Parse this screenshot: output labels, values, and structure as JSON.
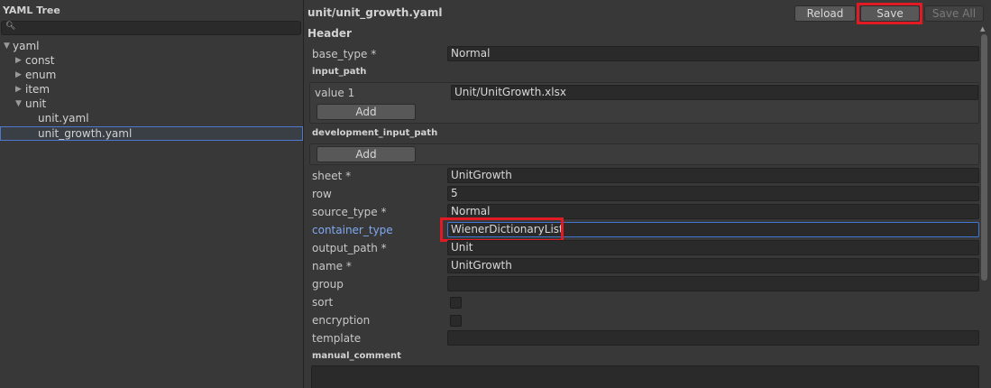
{
  "tree_panel": {
    "title": "YAML Tree",
    "search_placeholder": "",
    "items": [
      {
        "label": "yaml",
        "expanded": true
      },
      {
        "label": "const",
        "expanded": false
      },
      {
        "label": "enum",
        "expanded": false
      },
      {
        "label": "item",
        "expanded": false
      },
      {
        "label": "unit",
        "expanded": true
      },
      {
        "label": "unit.yaml"
      },
      {
        "label": "unit_growth.yaml",
        "selected": true
      }
    ]
  },
  "editor": {
    "file_title": "unit/unit_growth.yaml",
    "section": "Header",
    "buttons": {
      "reload": "Reload",
      "save": "Save",
      "save_all": "Save All"
    },
    "fields": {
      "base_type": {
        "label": "base_type *",
        "value": "Normal"
      },
      "input_path": {
        "label": "input_path",
        "item_label": "value 1",
        "item_value": "Unit/UnitGrowth.xlsx",
        "add": "Add"
      },
      "development_input_path": {
        "label": "development_input_path",
        "add": "Add"
      },
      "sheet": {
        "label": "sheet *",
        "value": "UnitGrowth"
      },
      "row": {
        "label": "row",
        "value": "5"
      },
      "source_type": {
        "label": "source_type *",
        "value": "Normal"
      },
      "container_type": {
        "label": "container_type",
        "value": "WienerDictionaryList"
      },
      "output_path": {
        "label": "output_path *",
        "value": "Unit"
      },
      "name": {
        "label": "name *",
        "value": "UnitGrowth"
      },
      "group": {
        "label": "group",
        "value": ""
      },
      "sort": {
        "label": "sort",
        "checked": false
      },
      "encryption": {
        "label": "encryption",
        "checked": false
      },
      "template": {
        "label": "template",
        "value": ""
      },
      "manual_comment": {
        "label": "manual_comment",
        "value": ""
      }
    }
  },
  "colors": {
    "highlight": "#e01b24",
    "link_label": "#80a9f2",
    "focus_border": "#3e77d1"
  },
  "icons": {
    "search": "search-icon",
    "expanded": "triangle-down-icon",
    "collapsed": "triangle-right-icon"
  }
}
